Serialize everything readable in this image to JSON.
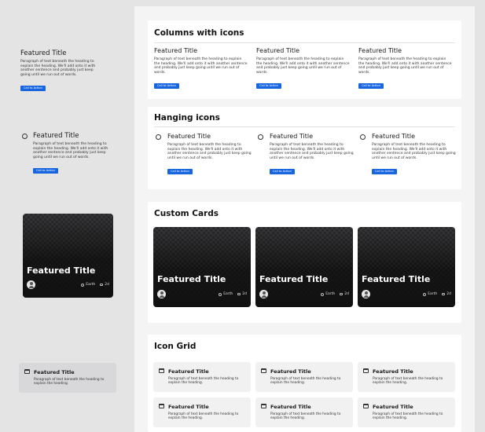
{
  "featured_title": "Featured Title",
  "paragraph": "Paragraph of text beneath the heading to explain the heading. We'll add onto it with another sentence and probably just keep going until we run out of words.",
  "short_paragraph": "Paragraph of text beneath the heading to explain the heading.",
  "cta_label": "Call to Action",
  "card": {
    "title": "Featured Title",
    "location": "Earth",
    "comments": "2d"
  },
  "sections": {
    "columns": "Columns with icons",
    "hanging": "Hanging icons",
    "cards": "Custom Cards",
    "grid": "Icon Grid"
  },
  "colors": {
    "accent": "#1766e0",
    "panel": "#f4f4f5",
    "background": "#e4e4e5"
  },
  "icons": {
    "hanging": "circle-icon",
    "grid": "calendar-icon",
    "card_avatar": "person-icon"
  }
}
